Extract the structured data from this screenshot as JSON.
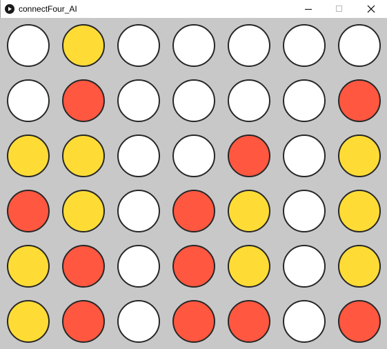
{
  "window": {
    "title": "connectFour_AI",
    "app_icon": "processing-play-icon",
    "controls": [
      "minimize-icon",
      "maximize-icon",
      "close-icon"
    ]
  },
  "colors": {
    "board": "#c8c8c8",
    "empty": "#ffffff",
    "red": "#ff5740",
    "yellow": "#ffdc35",
    "outline": "#262626"
  },
  "board": {
    "rows": 6,
    "columns": 7,
    "cells": [
      [
        "empty",
        "yellow",
        "empty",
        "empty",
        "empty",
        "empty",
        "empty"
      ],
      [
        "empty",
        "red",
        "empty",
        "empty",
        "empty",
        "empty",
        "red"
      ],
      [
        "yellow",
        "yellow",
        "empty",
        "empty",
        "red",
        "empty",
        "yellow"
      ],
      [
        "red",
        "yellow",
        "empty",
        "red",
        "yellow",
        "empty",
        "yellow"
      ],
      [
        "yellow",
        "red",
        "empty",
        "red",
        "yellow",
        "empty",
        "yellow"
      ],
      [
        "yellow",
        "red",
        "empty",
        "red",
        "red",
        "empty",
        "red"
      ]
    ]
  }
}
